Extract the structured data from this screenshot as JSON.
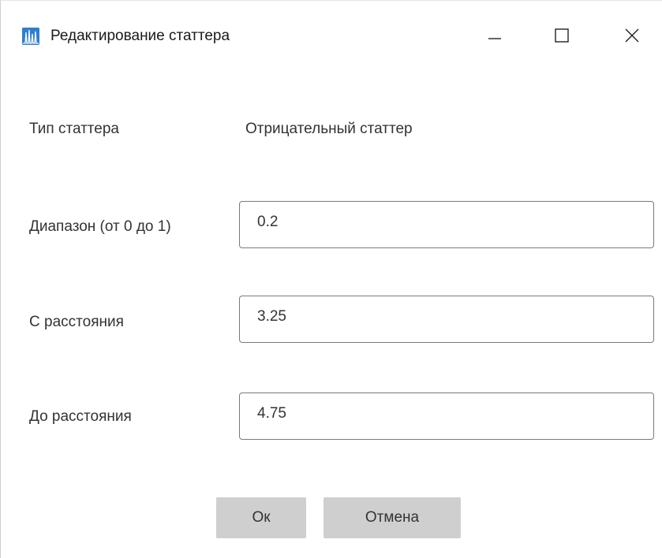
{
  "window": {
    "title": "Редактирование статтера",
    "app_icon": "spectrum-chart-icon",
    "controls": {
      "minimize_icon": "minimize-icon",
      "maximize_icon": "maximize-icon",
      "close_icon": "close-icon"
    }
  },
  "form": {
    "stutter_type": {
      "label": "Тип статтера",
      "value": "Отрицательный статтер"
    },
    "range": {
      "label": "Диапазон (от 0 до 1)",
      "value": "0.2"
    },
    "from_distance": {
      "label": "С расстояния",
      "value": "3.25"
    },
    "to_distance": {
      "label": "До расстояния",
      "value": "4.75"
    }
  },
  "buttons": {
    "ok_label": "Ок",
    "cancel_label": "Отмена"
  },
  "colors": {
    "accent": "#2f7fd0",
    "button_bg": "#cfcfcf",
    "field_border": "#7a7a7a"
  }
}
